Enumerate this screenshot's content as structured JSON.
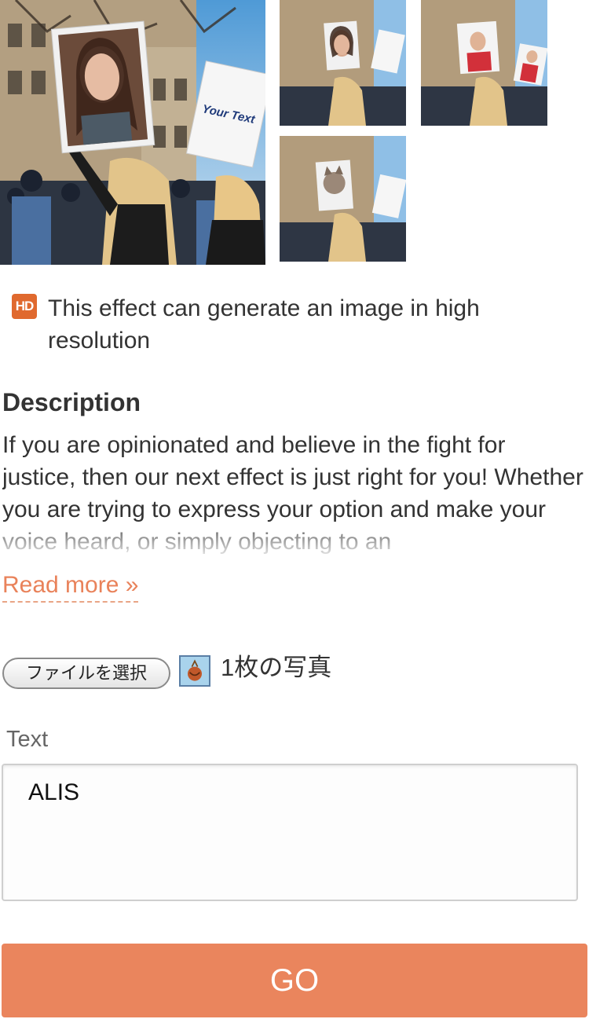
{
  "preview": {
    "main_sign_text": "Your Text"
  },
  "hd_note": {
    "badge": "HD",
    "text": "This effect can generate an image in high resolution"
  },
  "description": {
    "title": "Description",
    "body": "If you are opinionated and believe in the fight for justice, then our next effect is just right for you! Whether you are trying to express your option and make your voice heard, or simply objecting to an",
    "read_more": "Read more »"
  },
  "file_select": {
    "button_label": "ファイルを選択",
    "count_text": "1枚の写真"
  },
  "text_input": {
    "label": "Text",
    "value": "ALIS"
  },
  "go_button": {
    "label": "GO"
  },
  "colors": {
    "accent": "#ea855d",
    "hd_badge": "#e0692e",
    "link": "#e9825a"
  }
}
